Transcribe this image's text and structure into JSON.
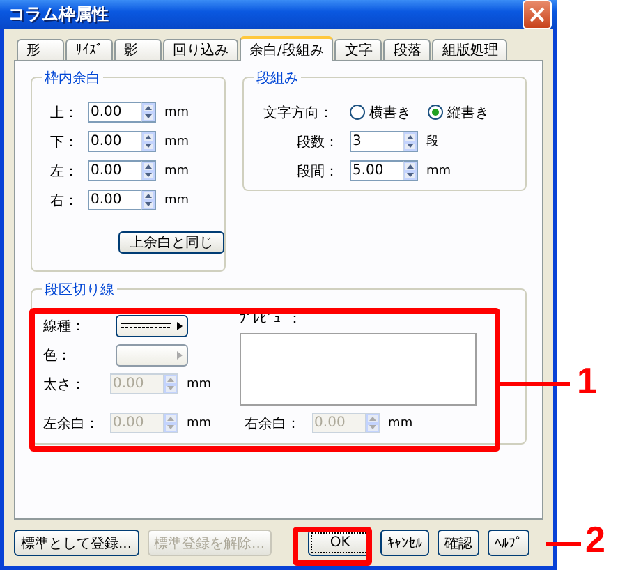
{
  "window": {
    "title": "コラム枠属性"
  },
  "tabs": [
    {
      "label": "形",
      "selected": false
    },
    {
      "label": "ｻｲｽﾞ",
      "selected": false
    },
    {
      "label": "影",
      "selected": false
    },
    {
      "label": "回り込み",
      "selected": false
    },
    {
      "label": "余白/段組み",
      "selected": true
    },
    {
      "label": "文字",
      "selected": false
    },
    {
      "label": "段落",
      "selected": false
    },
    {
      "label": "組版処理",
      "selected": false
    }
  ],
  "inner_margin": {
    "title": "枠内余白",
    "fields": [
      {
        "label": "上：",
        "value": "0.00",
        "unit": "mm"
      },
      {
        "label": "下：",
        "value": "0.00",
        "unit": "mm"
      },
      {
        "label": "左：",
        "value": "0.00",
        "unit": "mm"
      },
      {
        "label": "右：",
        "value": "0.00",
        "unit": "mm"
      }
    ],
    "button": "上余白と同じ"
  },
  "columns": {
    "title": "段組み",
    "direction_label": "文字方向：",
    "options": [
      {
        "label": "横書き",
        "selected": false
      },
      {
        "label": "縦書き",
        "selected": true
      }
    ],
    "fields": [
      {
        "label": "段数：",
        "value": "3",
        "unit": "段"
      },
      {
        "label": "段間：",
        "value": "5.00",
        "unit": "mm"
      }
    ]
  },
  "column_rule": {
    "title": "段区切り線",
    "line_type": {
      "label": "線種：",
      "disabled": false
    },
    "color": {
      "label": "色：",
      "disabled": true
    },
    "width": {
      "label": "太さ：",
      "value": "0.00",
      "unit": "mm",
      "disabled": true
    },
    "preview_label": "ﾌﾟﾚﾋﾞｭｰ：",
    "left_margin": {
      "label": "左余白：",
      "value": "0.00",
      "unit": "mm",
      "disabled": true
    },
    "right_margin": {
      "label": "右余白：",
      "value": "0.00",
      "unit": "mm",
      "disabled": true
    }
  },
  "footer_buttons": [
    {
      "label": "標準として登録...",
      "disabled": false,
      "focused": false
    },
    {
      "label": "標準登録を解除...",
      "disabled": true,
      "focused": false
    },
    {
      "label": "OK",
      "disabled": false,
      "focused": true
    },
    {
      "label": "ｷｬﾝｾﾙ",
      "disabled": false,
      "focused": false
    },
    {
      "label": "確認",
      "disabled": false,
      "focused": false
    },
    {
      "label": "ﾍﾙﾌﾟ",
      "disabled": false,
      "focused": false
    }
  ],
  "callouts": [
    {
      "number": "1"
    },
    {
      "number": "2"
    }
  ]
}
